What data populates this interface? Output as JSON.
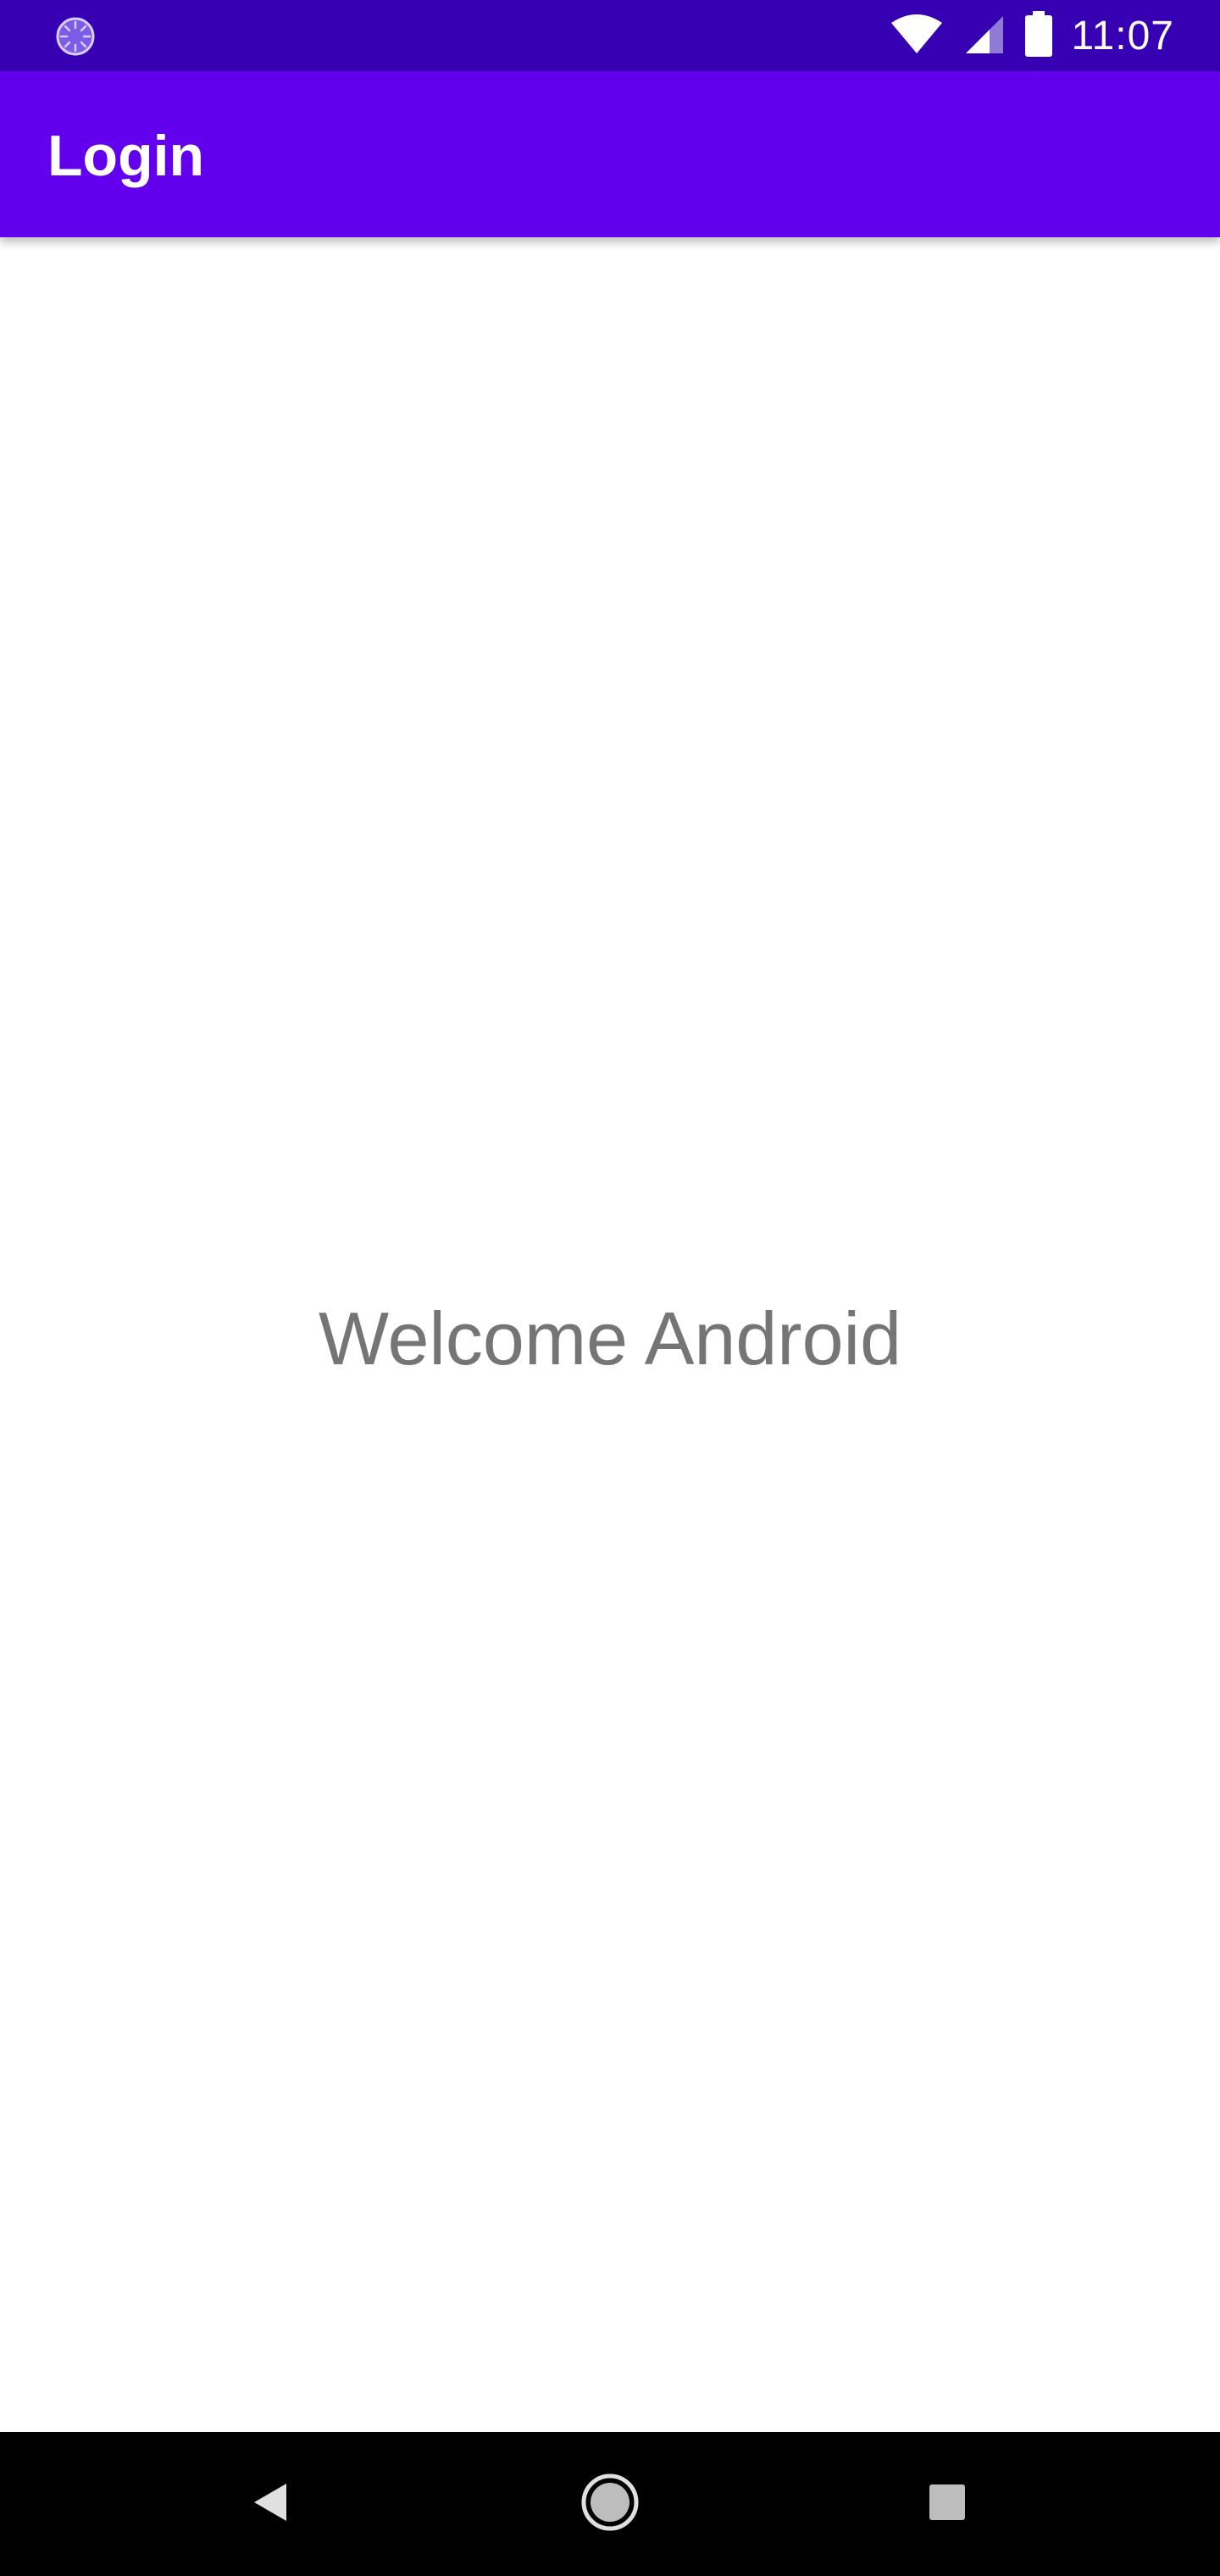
{
  "status_bar": {
    "time": "11:07",
    "icons": [
      "sync-icon",
      "wifi-icon",
      "cellular-signal-icon",
      "battery-icon"
    ],
    "background": "#3700b3"
  },
  "app_bar": {
    "title": "Login",
    "background": "#6200ee"
  },
  "content": {
    "welcome_text": "Welcome Android",
    "text_color": "#757575"
  },
  "nav_bar": {
    "buttons": [
      "back-icon",
      "home-icon",
      "recents-icon"
    ]
  }
}
